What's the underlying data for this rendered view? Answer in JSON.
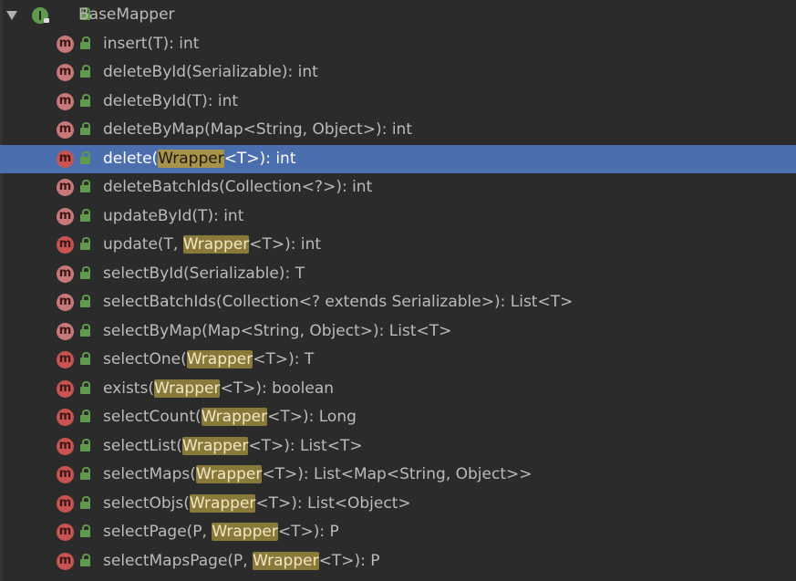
{
  "tree": {
    "root": {
      "label": "BaseMapper",
      "icon": "interface-icon",
      "expanded": true
    },
    "methods": [
      {
        "pre": "insert(T): int",
        "hl": "",
        "post": ""
      },
      {
        "pre": "deleteById(Serializable): int",
        "hl": "",
        "post": ""
      },
      {
        "pre": "deleteById(T): int",
        "hl": "",
        "post": ""
      },
      {
        "pre": "deleteByMap(Map<String, Object>): int",
        "hl": "",
        "post": ""
      },
      {
        "pre": "delete(",
        "hl": "Wrapper",
        "post": "<T>): int",
        "selected": true
      },
      {
        "pre": "deleteBatchIds(Collection<?>): int",
        "hl": "",
        "post": ""
      },
      {
        "pre": "updateById(T): int",
        "hl": "",
        "post": ""
      },
      {
        "pre": "update(T, ",
        "hl": "Wrapper",
        "post": "<T>): int"
      },
      {
        "pre": "selectById(Serializable): T",
        "hl": "",
        "post": ""
      },
      {
        "pre": "selectBatchIds(Collection<? extends Serializable>): List<T>",
        "hl": "",
        "post": ""
      },
      {
        "pre": "selectByMap(Map<String, Object>): List<T>",
        "hl": "",
        "post": ""
      },
      {
        "pre": "selectOne(",
        "hl": "Wrapper",
        "post": "<T>): T"
      },
      {
        "pre": "exists(",
        "hl": "Wrapper",
        "post": "<T>): boolean"
      },
      {
        "pre": "selectCount(",
        "hl": "Wrapper",
        "post": "<T>): Long"
      },
      {
        "pre": "selectList(",
        "hl": "Wrapper",
        "post": "<T>): List<T>"
      },
      {
        "pre": "selectMaps(",
        "hl": "Wrapper",
        "post": "<T>): List<Map<String, Object>>"
      },
      {
        "pre": "selectObjs(",
        "hl": "Wrapper",
        "post": "<T>): List<Object>"
      },
      {
        "pre": "selectPage(P, ",
        "hl": "Wrapper",
        "post": "<T>): P"
      },
      {
        "pre": "selectMapsPage(P, ",
        "hl": "Wrapper",
        "post": "<T>): P"
      }
    ]
  },
  "icons": {
    "method": "method-m-icon",
    "access": "public-lock-icon",
    "expander": "triangle-down-icon"
  },
  "colors": {
    "background": "#2b2b2b",
    "selection": "#4b6eaf",
    "match_highlight": "#8a7a3a",
    "method_icon": "#c75450",
    "access_icon": "#5f9a4d"
  }
}
